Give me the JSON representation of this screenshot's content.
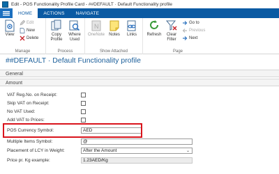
{
  "window": {
    "title": "Edit - POS Functionality Profile Card - ##DEFAULT · Default Functionality profile"
  },
  "tabs": [
    {
      "label": "HOME"
    },
    {
      "label": "ACTIONS"
    },
    {
      "label": "NAVIGATE"
    }
  ],
  "ribbon": {
    "manage": {
      "label": "Manage",
      "view": "View",
      "edit": "Edit",
      "new": "New",
      "delete": "Delete"
    },
    "process": {
      "label": "Process",
      "copy_profile": "Copy Profile",
      "where_used": "Where Used"
    },
    "show_attached": {
      "label": "Show Attached",
      "onenote": "OneNote",
      "notes": "Notes",
      "links": "Links"
    },
    "page": {
      "label": "Page",
      "refresh": "Refresh",
      "clear_filter": "Clear Filter",
      "go_to": "Go to",
      "previous": "Previous",
      "next": "Next"
    }
  },
  "page_title": "##DEFAULT · Default Functionality profile",
  "sections": {
    "general": "General",
    "amount": "Amount"
  },
  "fields": {
    "vat_reg_no": {
      "label": "VAT Reg.No. on Receipt:",
      "checked": false
    },
    "skip_vat": {
      "label": "Skip VAT on Receipt:",
      "checked": false
    },
    "no_vat_used": {
      "label": "No VAT Used:",
      "checked": false
    },
    "add_vat_to_prices": {
      "label": "Add VAT to Prices:",
      "checked": false
    },
    "pos_currency_symbol": {
      "label": "POS Currency Symbol:",
      "value": "AED"
    },
    "multiple_items_symbol": {
      "label": "Multiple Items Symbol:",
      "value": "@"
    },
    "placement_lcy": {
      "label": "Placement of LCY in Weight:",
      "value": "After the Amount"
    },
    "price_pr_kg": {
      "label": "Price pr. Kg example:",
      "value": "1.23AED/Kg"
    }
  },
  "colors": {
    "accent": "#0b5aa3",
    "title": "#1a5e9a",
    "highlight": "#d9141c"
  }
}
